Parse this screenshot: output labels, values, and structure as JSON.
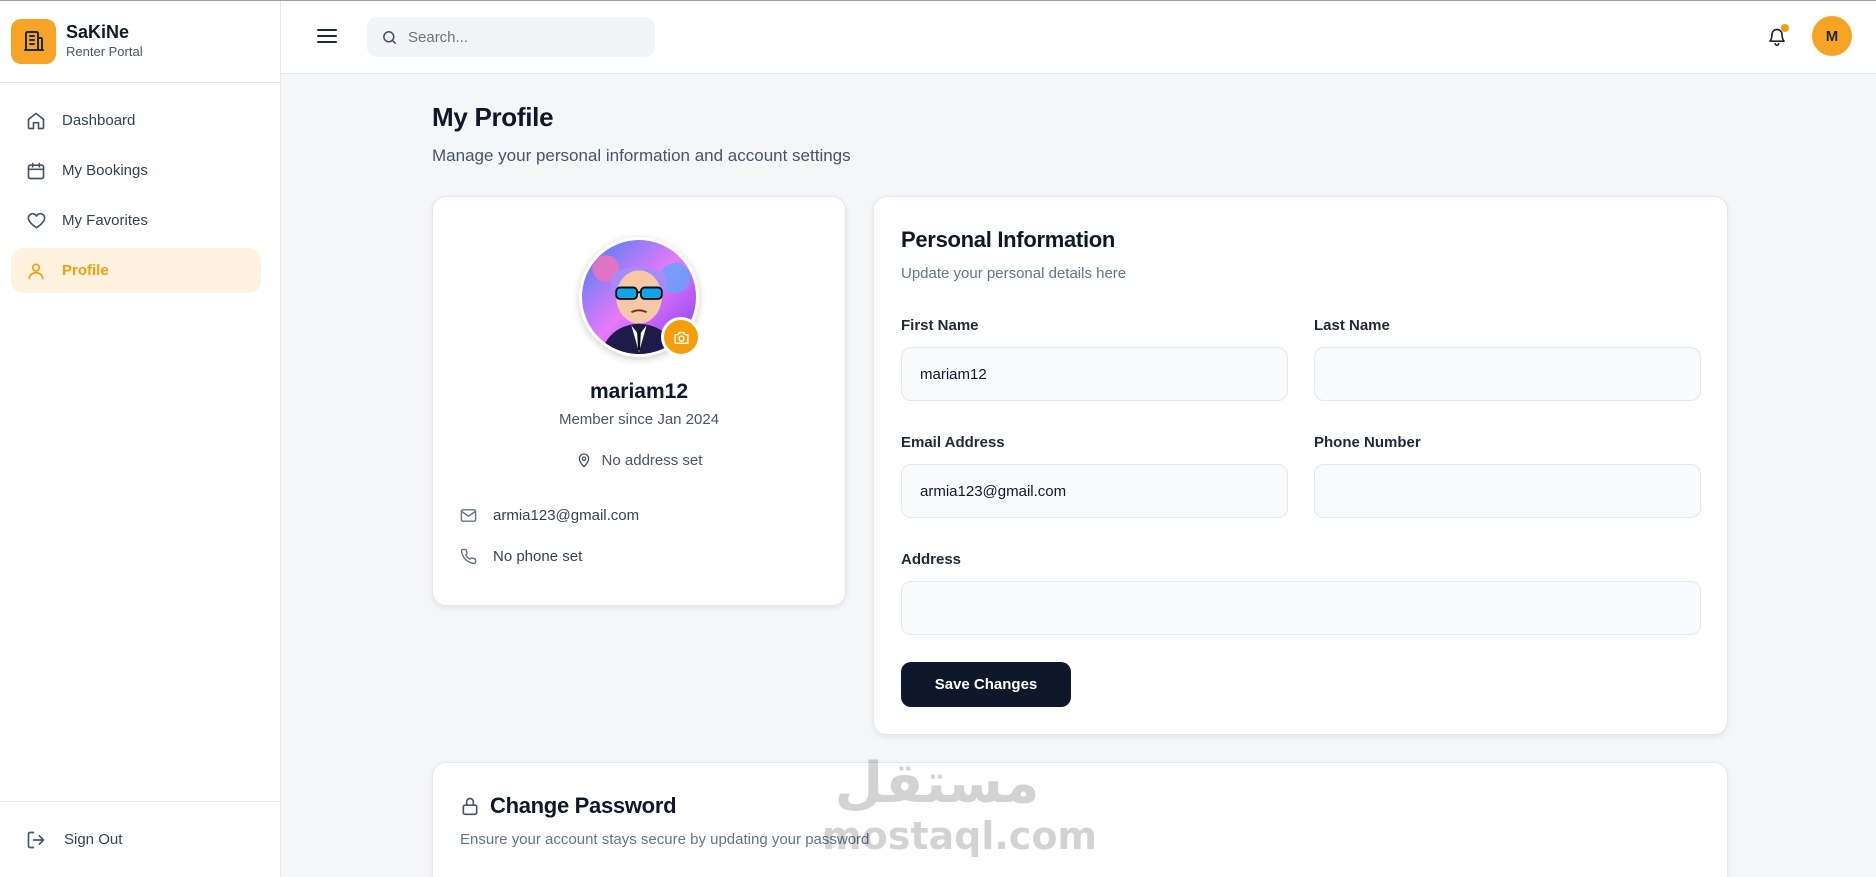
{
  "brand": {
    "name": "SaKiNe",
    "subtitle": "Renter Portal"
  },
  "sidebar": {
    "items": [
      {
        "label": "Dashboard",
        "icon": "home-icon"
      },
      {
        "label": "My Bookings",
        "icon": "calendar-icon"
      },
      {
        "label": "My Favorites",
        "icon": "heart-icon"
      },
      {
        "label": "Profile",
        "icon": "user-icon",
        "active": true
      }
    ],
    "sign_out": "Sign Out"
  },
  "header": {
    "search_placeholder": "Search...",
    "avatar_initial": "M",
    "notification_dot": true
  },
  "page": {
    "title": "My Profile",
    "subtitle": "Manage your personal information and account settings"
  },
  "profile_card": {
    "username": "mariam12",
    "member_since": "Member since Jan 2024",
    "address": "No address set",
    "email": "armia123@gmail.com",
    "phone": "No phone set"
  },
  "personal_info": {
    "title": "Personal Information",
    "subtitle": "Update your personal details here",
    "first_name_label": "First Name",
    "first_name_value": "mariam12",
    "last_name_label": "Last Name",
    "last_name_value": "",
    "email_label": "Email Address",
    "email_value": "armia123@gmail.com",
    "phone_label": "Phone Number",
    "phone_value": "",
    "address_label": "Address",
    "address_value": "",
    "save_label": "Save Changes"
  },
  "change_password": {
    "title": "Change Password",
    "subtitle": "Ensure your account stays secure by updating your password"
  },
  "watermark": {
    "arabic": "مستقل",
    "latin": "mostaql.com"
  },
  "colors": {
    "accent": "#f7a325",
    "dark": "#0f172a",
    "active_bg": "#fff3e0"
  }
}
